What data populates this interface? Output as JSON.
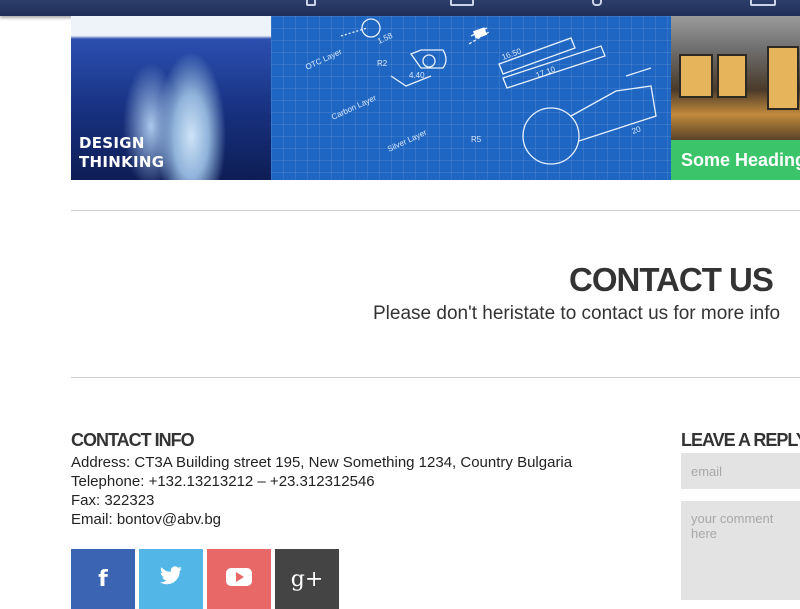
{
  "nav": {
    "icons": [
      "phone-icon",
      "mail-icon",
      "location-icon",
      "print-icon"
    ]
  },
  "portfolio": {
    "tiles": [
      {
        "name": "iceberg",
        "label_line1": "DESIGN",
        "label_line2": "THINKING"
      },
      {
        "name": "blueprint",
        "labels": [
          "OTC Layer",
          "Carbon Layer",
          "Silver Layer",
          "R5",
          "R2",
          "4.40",
          "1.58",
          "16.50",
          "17.10",
          "20"
        ]
      },
      {
        "name": "store",
        "heading": "Some Heading"
      }
    ]
  },
  "contact": {
    "title": "CONTACT US",
    "subtitle": "Please don't heristate to contact us for more info"
  },
  "contact_info": {
    "heading": "CONTACT INFO",
    "address": "Address: CT3A Building street 195, New Something 1234, Country Bulgaria",
    "telephone": "Telephone: +132.13213212 – +23.312312546",
    "fax": "Fax: 322323",
    "email": "Email: bontov@abv.bg"
  },
  "social": [
    {
      "name": "facebook",
      "glyph": "f",
      "color": "#3b64b3"
    },
    {
      "name": "twitter",
      "glyph": "🐦",
      "color": "#52b6e7"
    },
    {
      "name": "youtube",
      "glyph": "▶",
      "color": "#e86868"
    },
    {
      "name": "google-plus",
      "glyph": "g+",
      "color": "#444444"
    }
  ],
  "reply": {
    "heading": "LEAVE A REPLY",
    "email_placeholder": "email",
    "comment_placeholder": "your comment here"
  },
  "colors": {
    "nav_bg": "#24345f",
    "heading_tile": "#3bc46a",
    "text": "#333333",
    "field_bg": "#e3e3e3"
  }
}
